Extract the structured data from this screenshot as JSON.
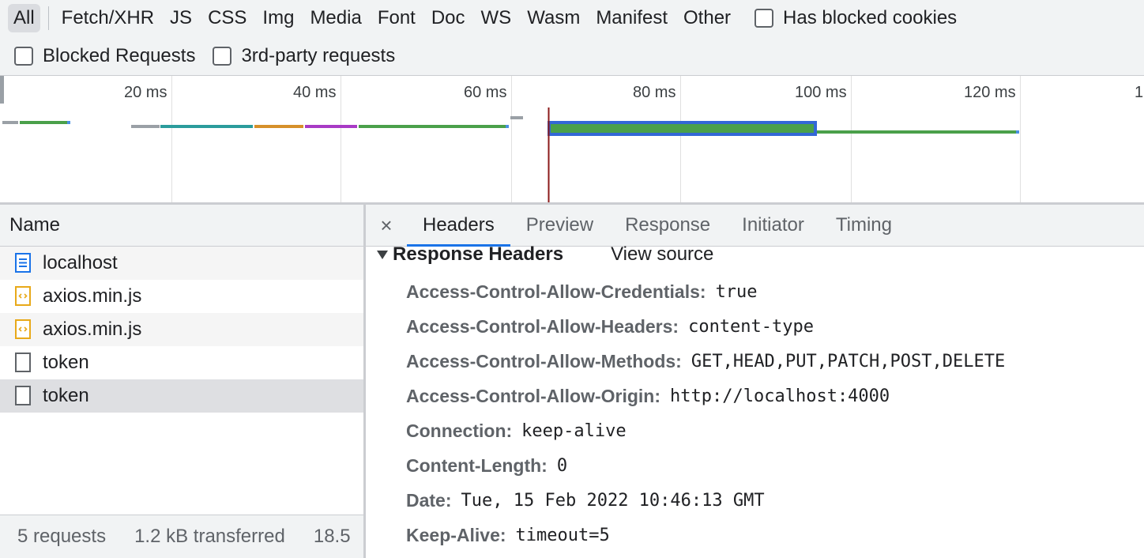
{
  "filters": {
    "types": [
      "All",
      "Fetch/XHR",
      "JS",
      "CSS",
      "Img",
      "Media",
      "Font",
      "Doc",
      "WS",
      "Wasm",
      "Manifest",
      "Other"
    ],
    "has_blocked_cookies": "Has blocked cookies",
    "blocked_requests": "Blocked Requests",
    "third_party": "3rd-party requests"
  },
  "overview": {
    "ticks": [
      "20 ms",
      "40 ms",
      "60 ms",
      "80 ms",
      "100 ms",
      "120 ms",
      "1"
    ],
    "colors": {
      "waiting": "#9aa0a6",
      "connection": "#2b9c9c",
      "ssl": "#d6902a",
      "sending": "#a83ac5",
      "ttfb": "#4aa04a",
      "download": "#4a90e2",
      "marker": "#8b1a1a",
      "highlight": "#3367d6"
    }
  },
  "list": {
    "header": "Name",
    "rows": [
      {
        "name": "localhost",
        "icon": "document-icon"
      },
      {
        "name": "axios.min.js",
        "icon": "script-icon"
      },
      {
        "name": "axios.min.js",
        "icon": "script-icon"
      },
      {
        "name": "token",
        "icon": "blank-file-icon"
      },
      {
        "name": "token",
        "icon": "blank-file-icon"
      }
    ],
    "footer": {
      "requests": "5 requests",
      "transferred": "1.2 kB transferred",
      "resources": "18.5"
    }
  },
  "details": {
    "close": "×",
    "tabs": [
      "Headers",
      "Preview",
      "Response",
      "Initiator",
      "Timing"
    ],
    "section_title": "Response Headers",
    "view_source": "View source",
    "headers": [
      {
        "key": "Access-Control-Allow-Credentials:",
        "value": "true"
      },
      {
        "key": "Access-Control-Allow-Headers:",
        "value": "content-type"
      },
      {
        "key": "Access-Control-Allow-Methods:",
        "value": "GET,HEAD,PUT,PATCH,POST,DELETE"
      },
      {
        "key": "Access-Control-Allow-Origin:",
        "value": "http://localhost:4000"
      },
      {
        "key": "Connection:",
        "value": "keep-alive"
      },
      {
        "key": "Content-Length:",
        "value": "0"
      },
      {
        "key": "Date:",
        "value": "Tue, 15 Feb 2022 10:46:13 GMT"
      },
      {
        "key": "Keep-Alive:",
        "value": "timeout=5"
      }
    ]
  }
}
